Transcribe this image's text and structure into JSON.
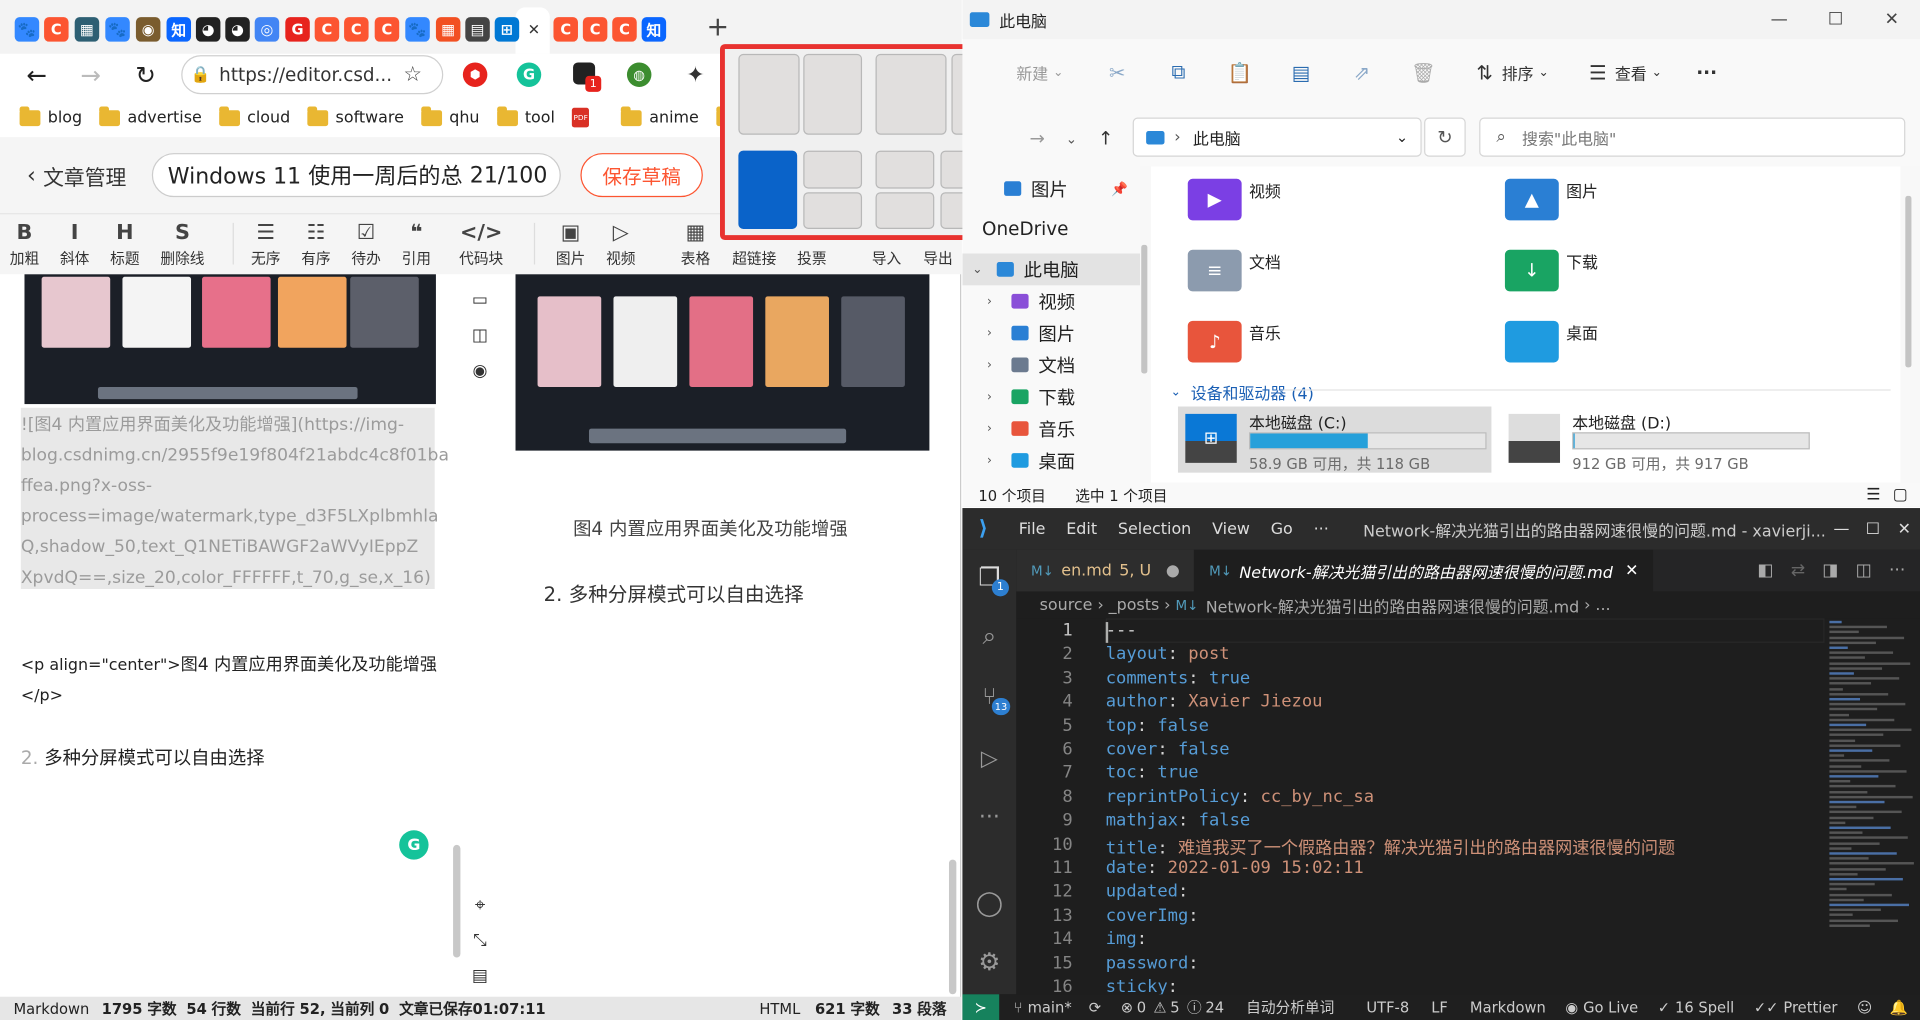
{
  "browser": {
    "tab_icon_names": [
      "baidu-tab-icon",
      "csdn-tab-icon",
      "image-tab-icon",
      "baidu-tab-icon",
      "sdu-tab-icon",
      "zhihu-tab-icon",
      "github-tab-icon",
      "github-tab-icon",
      "chrome-tab-icon",
      "grammarly-tab-icon",
      "csdn-tab-icon",
      "csdn-tab-icon",
      "csdn-tab-icon",
      "baidu-tab-icon",
      "microsoft-tab-icon",
      "app-tab-icon",
      "windows-tab-icon",
      "close-tab-icon",
      "csdn-tab-icon",
      "csdn-tab-icon",
      "csdn-tab-icon",
      "zhihu-tab-icon"
    ],
    "new_tab": "+",
    "url": "https://editor.csd...",
    "bookmarks": [
      "blog",
      "advertise",
      "cloud",
      "software",
      "qhu",
      "tool",
      "anime"
    ],
    "article_manage": "文章管理",
    "title_value": "Windows 11 使用一周后的总",
    "title_count": "21/100",
    "save_draft": "保存草稿",
    "toolbar": [
      {
        "icon": "B",
        "label": "加粗"
      },
      {
        "icon": "I",
        "label": "斜体"
      },
      {
        "icon": "H",
        "label": "标题"
      },
      {
        "icon": "S",
        "label": "删除线"
      },
      {
        "icon": "☰",
        "label": "无序"
      },
      {
        "icon": "☷",
        "label": "有序"
      },
      {
        "icon": "☑",
        "label": "待办"
      },
      {
        "icon": "❝",
        "label": "引用"
      },
      {
        "icon": "</>",
        "label": "代码块"
      },
      {
        "icon": "▣",
        "label": "图片"
      },
      {
        "icon": "▷",
        "label": "视频"
      },
      {
        "icon": "▦",
        "label": "表格"
      },
      {
        "icon": "",
        "label": "超链接"
      },
      {
        "icon": "",
        "label": "投票"
      },
      {
        "icon": "",
        "label": "导入"
      },
      {
        "icon": "",
        "label": "导出"
      }
    ],
    "md_link_lines": [
      "![图4 内置应用界面美化及功能增强](https://img-",
      "blog.csdnimg.cn/2955f9e19f804f21abdc4c8f01ba",
      "ffea.png?x-oss-",
      "process=image/watermark,type_d3F5LXplbmhla",
      "Q,shadow_50,text_Q1NETiBAWGF2aWVyIEppZ",
      "XpvdQ==,size_20,color_FFFFFF,t_70,g_se,x_16)"
    ],
    "md_center_open": "<p align=\"center\">",
    "md_center_text": "图4 内置应用界面美化及功能增强",
    "md_center_close": "</p>",
    "md_list_num": "2.",
    "md_list_text": "多种分屏模式可以自由选择",
    "preview_caption": "图4 内置应用界面美化及功能增强",
    "preview_list": "2. 多种分屏模式可以自由选择",
    "status": {
      "mode": "Markdown",
      "chars": "1795",
      "chars_unit": "字数",
      "lines": "54",
      "lines_unit": "行数",
      "cursor_label": "当前行",
      "cursor_line": "52,",
      "cursor_col_label": "当前列",
      "cursor_col": "0",
      "saved": "文章已保存01:07:11",
      "html": "HTML",
      "html_chars": "621",
      "html_chars_unit": "字数",
      "paragraphs": "33",
      "paragraphs_unit": "段落"
    },
    "extension_badge": "1"
  },
  "snap_layouts": {
    "highlight_color": "#e8322f",
    "selected_color": "#0a63c9"
  },
  "explorer": {
    "title": "此电脑",
    "new": "新建",
    "sort": "排序",
    "view": "查看",
    "more": "···",
    "address": "此电脑",
    "search_placeholder": "搜索\"此电脑\"",
    "nav": [
      {
        "label": "图片",
        "pinned": true
      },
      {
        "label": "OneDrive"
      },
      {
        "label": "此电脑",
        "expanded": true,
        "selected": true
      },
      {
        "label": "视频"
      },
      {
        "label": "图片"
      },
      {
        "label": "文档"
      },
      {
        "label": "下载"
      },
      {
        "label": "音乐"
      },
      {
        "label": "桌面"
      }
    ],
    "folders": [
      "视频",
      "图片",
      "文档",
      "下载",
      "音乐",
      "桌面"
    ],
    "devices_header": "设备和驱动器 (4)",
    "drives": [
      {
        "name": "本地磁盘 (C:)",
        "free": "58.9 GB 可用，共 118 GB",
        "used_fraction": 0.5,
        "selected": true
      },
      {
        "name": "本地磁盘 (D:)",
        "free": "912 GB 可用，共 917 GB",
        "used_fraction": 0.005
      }
    ],
    "status_items": "10 个项目",
    "status_selected": "选中 1 个项目"
  },
  "vscode": {
    "menu": [
      "File",
      "Edit",
      "Selection",
      "View",
      "Go",
      "···"
    ],
    "title": "Network-解决光猫引出的路由器网速很慢的问题.md - xavierji...",
    "tabs": [
      {
        "label": "en.md",
        "badge": "5, U",
        "active": false
      },
      {
        "label": "Network-解决光猫引出的路由器网速很慢的问题.md",
        "active": true
      }
    ],
    "breadcrumb": [
      "source",
      "_posts",
      "Network-解决光猫引出的路由器网速很慢的问题.md",
      "..."
    ],
    "explorer_badge": "1",
    "scm_badge": "13",
    "lines": [
      {
        "n": "1",
        "key": "---",
        "val": ""
      },
      {
        "n": "2",
        "key": "layout",
        "val": "post"
      },
      {
        "n": "3",
        "key": "comments",
        "val": "true",
        "bool": true
      },
      {
        "n": "4",
        "key": "author",
        "val": "Xavier Jiezou"
      },
      {
        "n": "5",
        "key": "top",
        "val": "false",
        "bool": true
      },
      {
        "n": "6",
        "key": "cover",
        "val": "false",
        "bool": true
      },
      {
        "n": "7",
        "key": "toc",
        "val": "true",
        "bool": true
      },
      {
        "n": "8",
        "key": "reprintPolicy",
        "val": "cc_by_nc_sa"
      },
      {
        "n": "9",
        "key": "mathjax",
        "val": "false",
        "bool": true
      },
      {
        "n": "10",
        "key": "title",
        "val": "难道我买了一个假路由器？解决光猫引出的路由器网速很慢的问题"
      },
      {
        "n": "11",
        "key": "date",
        "val": "2022-01-09 15:02:11"
      },
      {
        "n": "12",
        "key": "updated",
        "val": ""
      },
      {
        "n": "13",
        "key": "coverImg",
        "val": ""
      },
      {
        "n": "14",
        "key": "img",
        "val": ""
      },
      {
        "n": "15",
        "key": "password",
        "val": ""
      },
      {
        "n": "16",
        "key": "sticky",
        "val": ""
      }
    ],
    "status": {
      "branch": "main*",
      "errors": "0",
      "warnings": "5",
      "info": "24",
      "autocorrect": "自动分析单词",
      "encoding": "UTF-8",
      "eol": "LF",
      "lang": "Markdown",
      "golive": "Go Live",
      "spell": "16 Spell",
      "prettier": "Prettier"
    }
  }
}
